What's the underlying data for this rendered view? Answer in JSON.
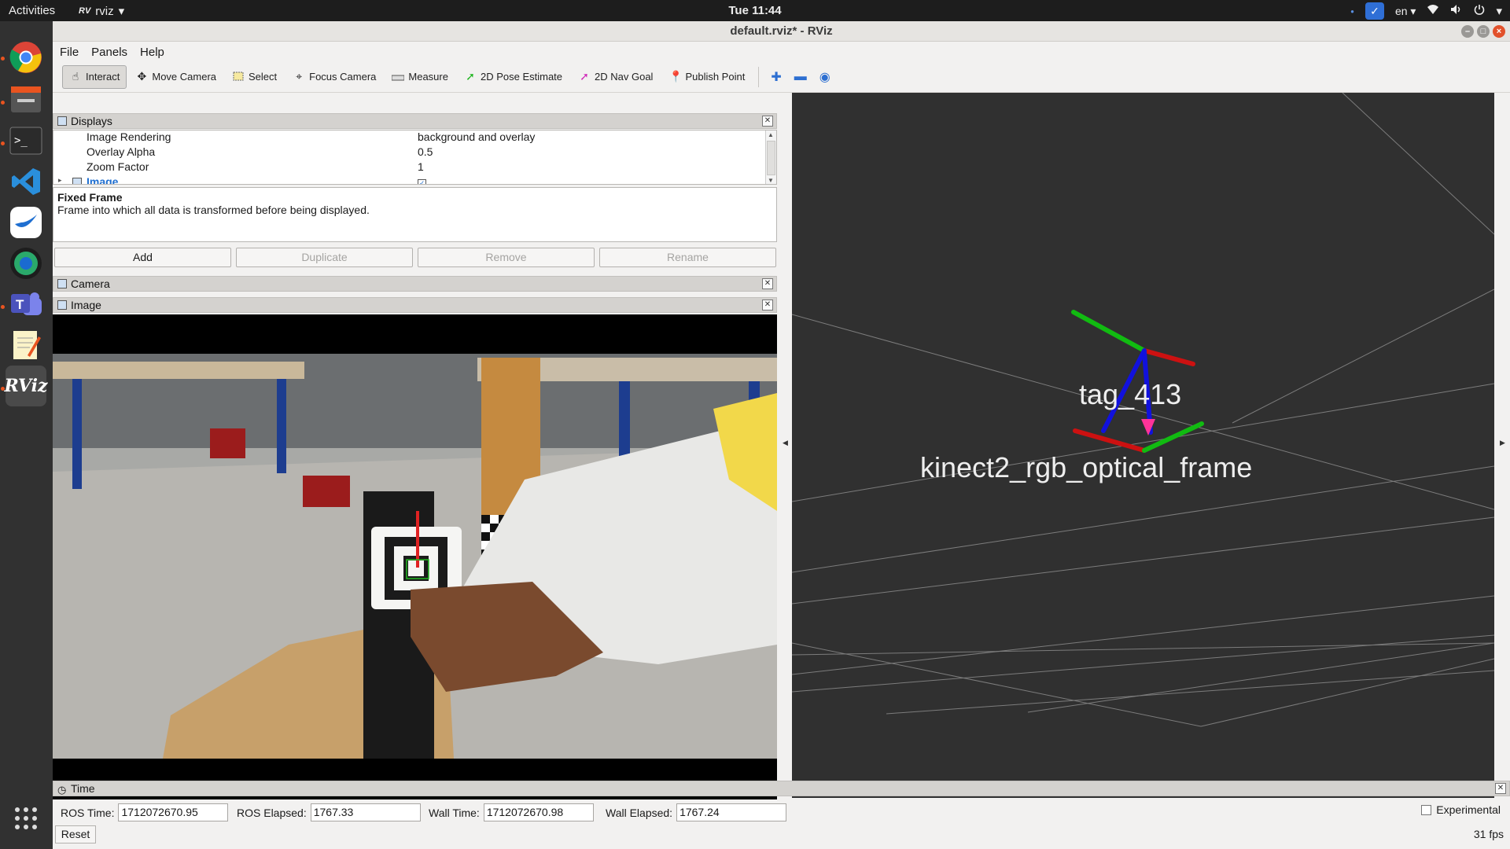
{
  "topbar": {
    "activities": "Activities",
    "app_name": "rviz",
    "clock": "Tue 11:44",
    "language": "en"
  },
  "window": {
    "title": "default.rviz* - RViz"
  },
  "menubar": {
    "file": "File",
    "panels": "Panels",
    "help": "Help"
  },
  "toolbar": {
    "interact": "Interact",
    "move_camera": "Move Camera",
    "select": "Select",
    "focus_camera": "Focus Camera",
    "measure": "Measure",
    "pose_estimate": "2D Pose Estimate",
    "nav_goal": "2D Nav Goal",
    "publish_point": "Publish Point"
  },
  "displays": {
    "title": "Displays",
    "rows": [
      {
        "key": "Image Rendering",
        "value": "background and overlay"
      },
      {
        "key": "Overlay Alpha",
        "value": "0.5"
      },
      {
        "key": "Zoom Factor",
        "value": "1"
      },
      {
        "key": "Image",
        "value": ""
      }
    ],
    "description_title": "Fixed Frame",
    "description_text": "Frame into which all data is transformed before being displayed.",
    "buttons": {
      "add": "Add",
      "duplicate": "Duplicate",
      "remove": "Remove",
      "rename": "Rename"
    }
  },
  "camera_panel": {
    "title": "Camera"
  },
  "image_panel": {
    "title": "Image"
  },
  "render_view": {
    "tag_label": "tag_413",
    "frame_label": "kinect2_rgb_optical_frame",
    "colors": {
      "background": "#303030",
      "grid": "#8a8a8a",
      "x_axis": "#cc1111",
      "y_axis": "#11bb11",
      "z_axis": "#1111dd",
      "marker": "#ff3399"
    }
  },
  "time_panel": {
    "title": "Time",
    "ros_time_label": "ROS Time:",
    "ros_time": "1712072670.95",
    "ros_elapsed_label": "ROS Elapsed:",
    "ros_elapsed": "1767.33",
    "wall_time_label": "Wall Time:",
    "wall_time": "1712072670.98",
    "wall_elapsed_label": "Wall Elapsed:",
    "wall_elapsed": "1767.24",
    "experimental": "Experimental",
    "reset": "Reset",
    "fps": "31 fps"
  }
}
